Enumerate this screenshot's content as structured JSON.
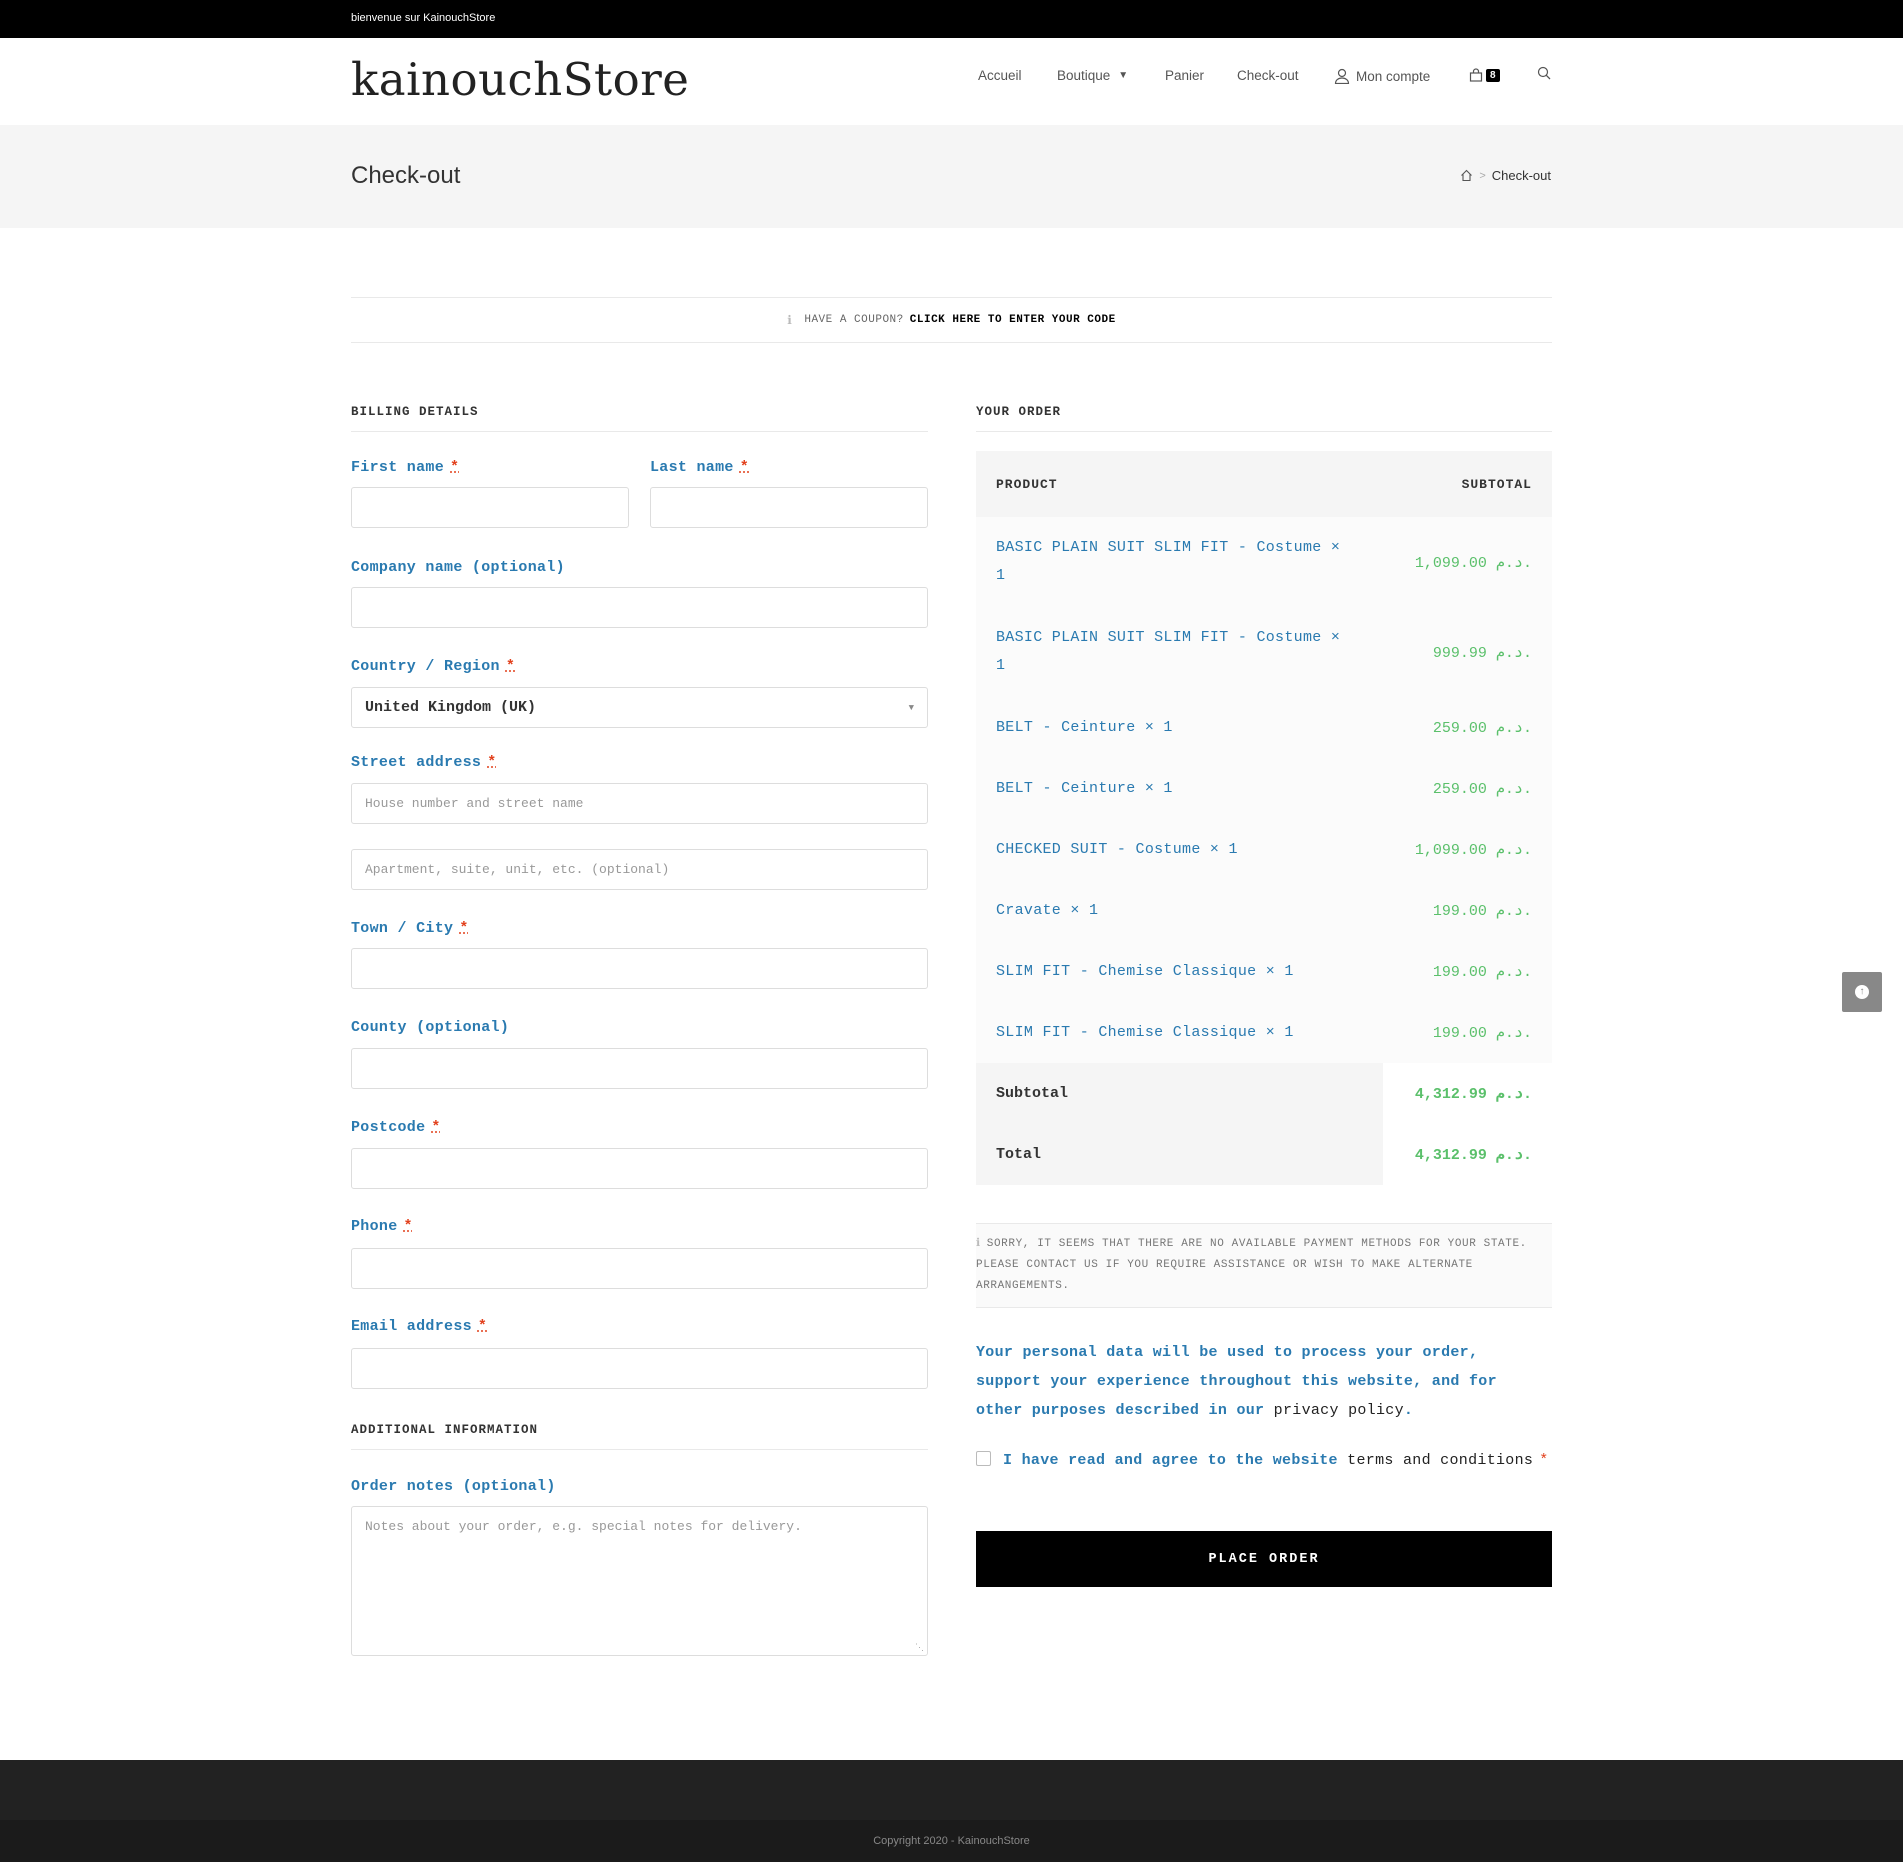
{
  "topbar": {
    "welcome": "bienvenue sur KainouchStore"
  },
  "header": {
    "logo": "kainouchStore",
    "nav": {
      "accueil": "Accueil",
      "boutique": "Boutique",
      "panier": "Panier",
      "checkout": "Check-out",
      "account": "Mon compte",
      "cart_count": "8"
    }
  },
  "titlebar": {
    "title": "Check-out",
    "breadcrumb_current": "Check-out"
  },
  "coupon": {
    "question": "HAVE A COUPON?",
    "link": "CLICK HERE TO ENTER YOUR CODE"
  },
  "billing": {
    "heading": "BILLING DETAILS",
    "first_name": "First name",
    "last_name": "Last name",
    "company": "Company name (optional)",
    "country": "Country / Region",
    "country_value": "United Kingdom (UK)",
    "street": "Street address",
    "street_ph1": "House number and street name",
    "street_ph2": "Apartment, suite, unit, etc. (optional)",
    "town": "Town / City",
    "county": "County (optional)",
    "postcode": "Postcode",
    "phone": "Phone",
    "email": "Email address",
    "required_mark": "*"
  },
  "additional": {
    "heading": "ADDITIONAL INFORMATION",
    "notes_label": "Order notes (optional)",
    "notes_ph": "Notes about your order, e.g. special notes for delivery."
  },
  "order": {
    "heading": "YOUR ORDER",
    "col_product": "PRODUCT",
    "col_subtotal": "SUBTOTAL",
    "items": [
      {
        "name": "BASIC PLAIN SUIT SLIM FIT - Costume  × 1",
        "price": "1,099.00 د.م."
      },
      {
        "name": "BASIC PLAIN SUIT SLIM FIT - Costume  × 1",
        "price": "999.99 د.م."
      },
      {
        "name": "BELT - Ceinture  × 1",
        "price": "259.00 د.م."
      },
      {
        "name": "BELT - Ceinture  × 1",
        "price": "259.00 د.م."
      },
      {
        "name": "CHECKED SUIT - Costume  × 1",
        "price": "1,099.00 د.م."
      },
      {
        "name": "Cravate  × 1",
        "price": "199.00 د.م."
      },
      {
        "name": "SLIM FIT - Chemise Classique  × 1",
        "price": "199.00 د.م."
      },
      {
        "name": "SLIM FIT - Chemise Classique  × 1",
        "price": "199.00 د.م."
      }
    ],
    "subtotal_label": "Subtotal",
    "subtotal_value": "4,312.99 د.م.",
    "total_label": "Total",
    "total_value": "4,312.99 د.م."
  },
  "payment_notice": "SORRY, IT SEEMS THAT THERE ARE NO AVAILABLE PAYMENT METHODS FOR YOUR STATE. PLEASE CONTACT US IF YOU REQUIRE ASSISTANCE OR WISH TO MAKE ALTERNATE ARRANGEMENTS.",
  "privacy": {
    "text": "Your personal data will be used to process your order, support your experience throughout this website, and for other purposes described in our",
    "link": "privacy policy",
    "end": "."
  },
  "terms": {
    "text": "I have read and agree to the website",
    "link": "terms and conditions",
    "star": "*"
  },
  "place_order": "PLACE ORDER",
  "footer": {
    "copyright": "Copyright 2020 - KainouchStore"
  },
  "icons": {
    "user": "user-icon",
    "cart": "shopping-bag-icon",
    "search": "search-icon",
    "home": "home-icon",
    "info": "info-icon",
    "scroll_top": "arrow-up-icon"
  },
  "colors": {
    "accent": "#2a7ab0",
    "price": "#5bc06b",
    "required": "#e2401c",
    "button": "#000000"
  }
}
